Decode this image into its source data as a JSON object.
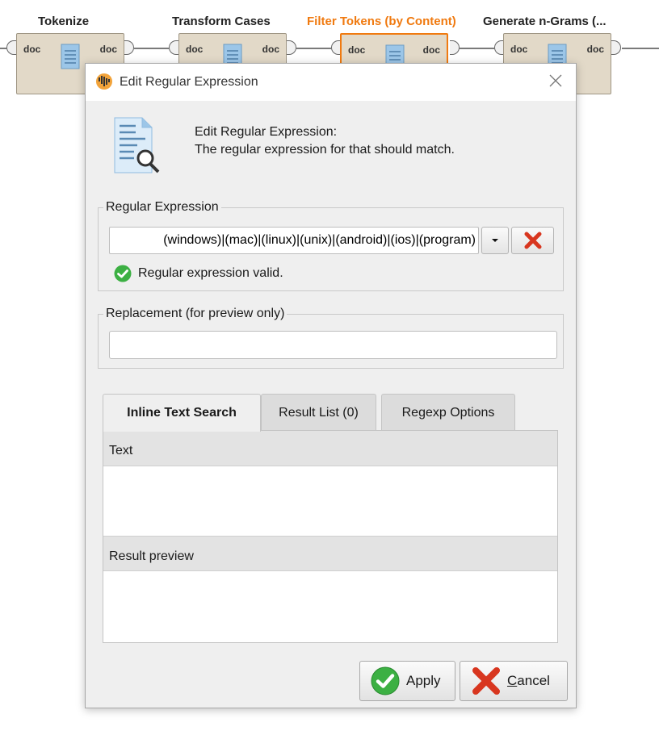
{
  "process": {
    "operators": [
      {
        "title": "Tokenize",
        "in_port": "doc",
        "out_port": "doc"
      },
      {
        "title": "Transform Cases",
        "in_port": "doc",
        "out_port": "doc"
      },
      {
        "title": "Filter Tokens (by Content)",
        "in_port": "doc",
        "out_port": "doc"
      },
      {
        "title": "Generate n-Grams (...",
        "in_port": "doc",
        "out_port": "doc"
      }
    ]
  },
  "dialog": {
    "title": "Edit Regular Expression",
    "header_line1": "Edit Regular Expression:",
    "header_line2": "The regular expression for that should match.",
    "regex_group_label": "Regular Expression",
    "regex_value": "(windows)|(mac)|(linux)|(unix)|(android)|(ios)|(program)",
    "valid_message": "Regular expression valid.",
    "replacement_group_label": "Replacement (for preview only)",
    "replacement_value": "",
    "tabs": [
      {
        "label": "Inline Text Search",
        "active": true
      },
      {
        "label": "Result List (0)",
        "active": false
      },
      {
        "label": "Regexp Options",
        "active": false
      }
    ],
    "text_section_label": "Text",
    "result_preview_label": "Result preview",
    "apply_label": "Apply",
    "cancel_mnemonic": "C",
    "cancel_rest": "ancel"
  },
  "colors": {
    "accent_orange": "#f07a10",
    "valid_green": "#3cb043",
    "cancel_red": "#d8361f"
  }
}
